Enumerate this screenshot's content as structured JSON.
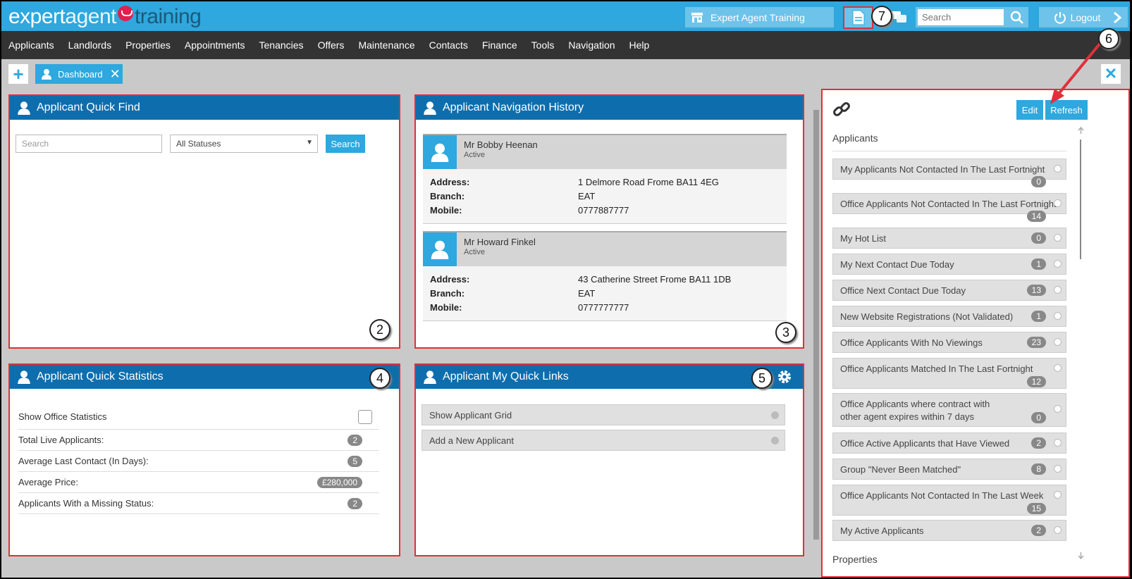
{
  "logo": {
    "part1": "expert",
    "part2": "agent",
    "part3": "training"
  },
  "topbar": {
    "office_label": "Expert Agent Training",
    "search_placeholder": "Search",
    "logout_label": "Logout"
  },
  "nav": [
    "Applicants",
    "Landlords",
    "Properties",
    "Appointments",
    "Tenancies",
    "Offers",
    "Maintenance",
    "Contacts",
    "Finance",
    "Tools",
    "Navigation",
    "Help"
  ],
  "tabs": {
    "dashboard_label": "Dashboard"
  },
  "quick_find": {
    "title": "Applicant Quick Find",
    "search_placeholder": "Search",
    "status_value": "All Statuses",
    "search_button": "Search"
  },
  "nav_history": {
    "title": "Applicant Navigation History",
    "labels": {
      "address": "Address:",
      "branch": "Branch:",
      "mobile": "Mobile:"
    },
    "records": [
      {
        "name": "Mr Bobby Heenan",
        "status": "Active",
        "address": "1 Delmore Road Frome BA11 4EG",
        "branch": "EAT",
        "mobile": "0777887777"
      },
      {
        "name": "Mr Howard Finkel",
        "status": "Active",
        "address": "43 Catherine Street Frome BA11 1DB",
        "branch": "EAT",
        "mobile": "0777777777"
      }
    ]
  },
  "quick_stats": {
    "title": "Applicant Quick Statistics",
    "show_office_label": "Show Office Statistics",
    "rows": [
      {
        "label": "Total Live Applicants:",
        "value": "2"
      },
      {
        "label": "Average Last Contact (In Days):",
        "value": "5"
      },
      {
        "label": "Average Price:",
        "value": "£280,000"
      },
      {
        "label": "Applicants With a Missing Status:",
        "value": "2"
      }
    ]
  },
  "quick_links": {
    "title": "Applicant My Quick Links",
    "items": [
      "Show Applicant Grid",
      "Add a New Applicant"
    ]
  },
  "sidebar": {
    "edit_label": "Edit",
    "refresh_label": "Refresh",
    "section_applicants": "Applicants",
    "section_properties": "Properties",
    "items": [
      {
        "label": "My Applicants Not Contacted In The Last Fortnight",
        "count": "0"
      },
      {
        "label": "Office Applicants Not Contacted In The Last Fortnight",
        "count": "14"
      },
      {
        "label": "My Hot List",
        "count": "0"
      },
      {
        "label": "My Next Contact Due Today",
        "count": "1"
      },
      {
        "label": "Office Next Contact Due Today",
        "count": "13"
      },
      {
        "label": "New Website Registrations (Not Validated)",
        "count": "1"
      },
      {
        "label": "Office Applicants With No Viewings",
        "count": "23"
      },
      {
        "label": "Office Applicants Matched In The Last Fortnight",
        "count": "12"
      },
      {
        "label": "Office Applicants where contract with",
        "label2": "other agent expires within 7 days",
        "count": "0"
      },
      {
        "label": "Office Active Applicants that Have Viewed",
        "count": "2"
      },
      {
        "label": "Group \"Never Been Matched\"",
        "count": "8"
      },
      {
        "label": "Office Applicants Not Contacted In The Last Week",
        "count": "15"
      },
      {
        "label": "My Active Applicants",
        "count": "2"
      }
    ]
  },
  "callouts": [
    "2",
    "3",
    "4",
    "5",
    "6",
    "7"
  ],
  "colors": {
    "accent": "#2ea8de",
    "panel_header": "#0e6ead",
    "highlight": "#e0303a"
  }
}
